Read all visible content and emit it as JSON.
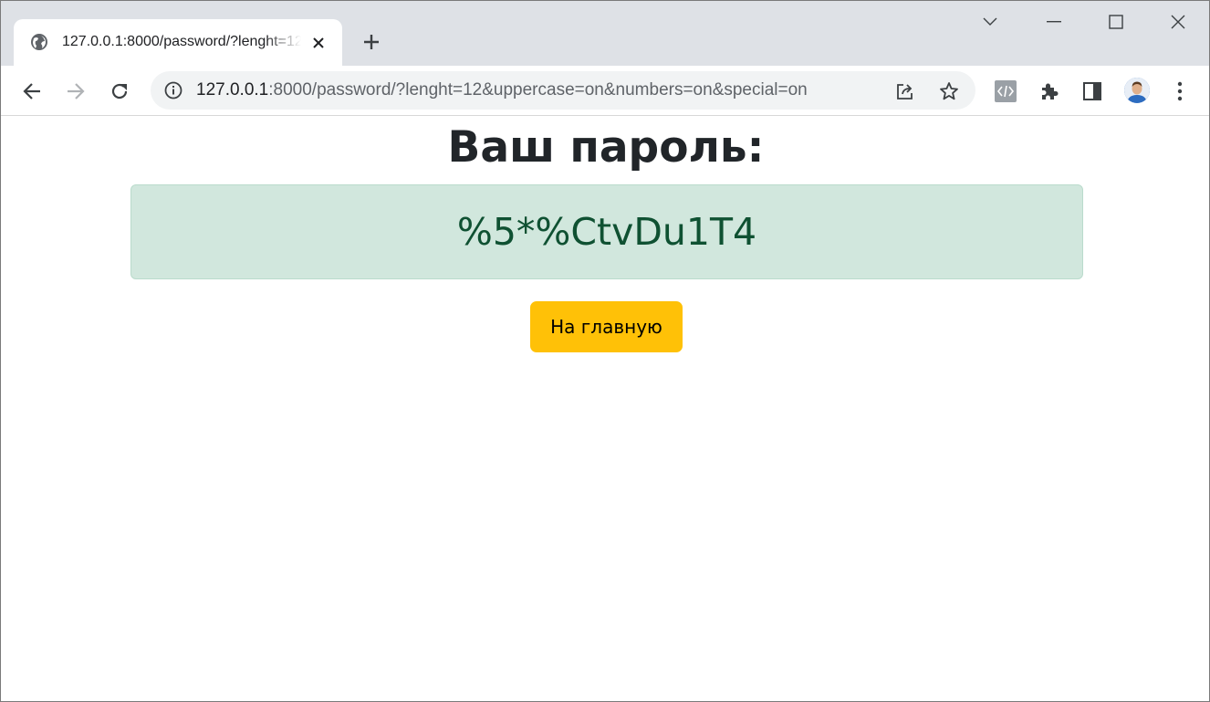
{
  "browser": {
    "tab": {
      "title": "127.0.0.1:8000/password/?lenght=12&uppercase=on&numbers=on&special=on",
      "favicon": "globe-icon",
      "close": "close-icon"
    },
    "new_tab": "plus-icon",
    "window_controls": [
      "tab-search-icon",
      "minimize-icon",
      "maximize-icon",
      "close-window-icon"
    ],
    "toolbar": {
      "back": "arrow-left-icon",
      "forward": "arrow-right-icon",
      "reload": "reload-icon",
      "site_info": "info-icon",
      "url_host": "127.0.0.1",
      "url_rest": ":8000/password/?lenght=12&uppercase=on&numbers=on&special=on",
      "share": "share-icon",
      "bookmark": "star-icon",
      "extensions": [
        "code-extension-icon",
        "puzzle-icon",
        "side-panel-icon"
      ],
      "menu": "kebab-menu-icon"
    }
  },
  "page": {
    "heading": "Ваш пароль:",
    "password": "%5*%CtvDu1T4",
    "home_button": "На главную"
  },
  "colors": {
    "tabstrip": "#dee1e6",
    "alert_bg": "#d1e7dd",
    "alert_border": "#badbcc",
    "alert_text": "#0f5132",
    "button_bg": "#ffc107",
    "heading_text": "#212529"
  }
}
